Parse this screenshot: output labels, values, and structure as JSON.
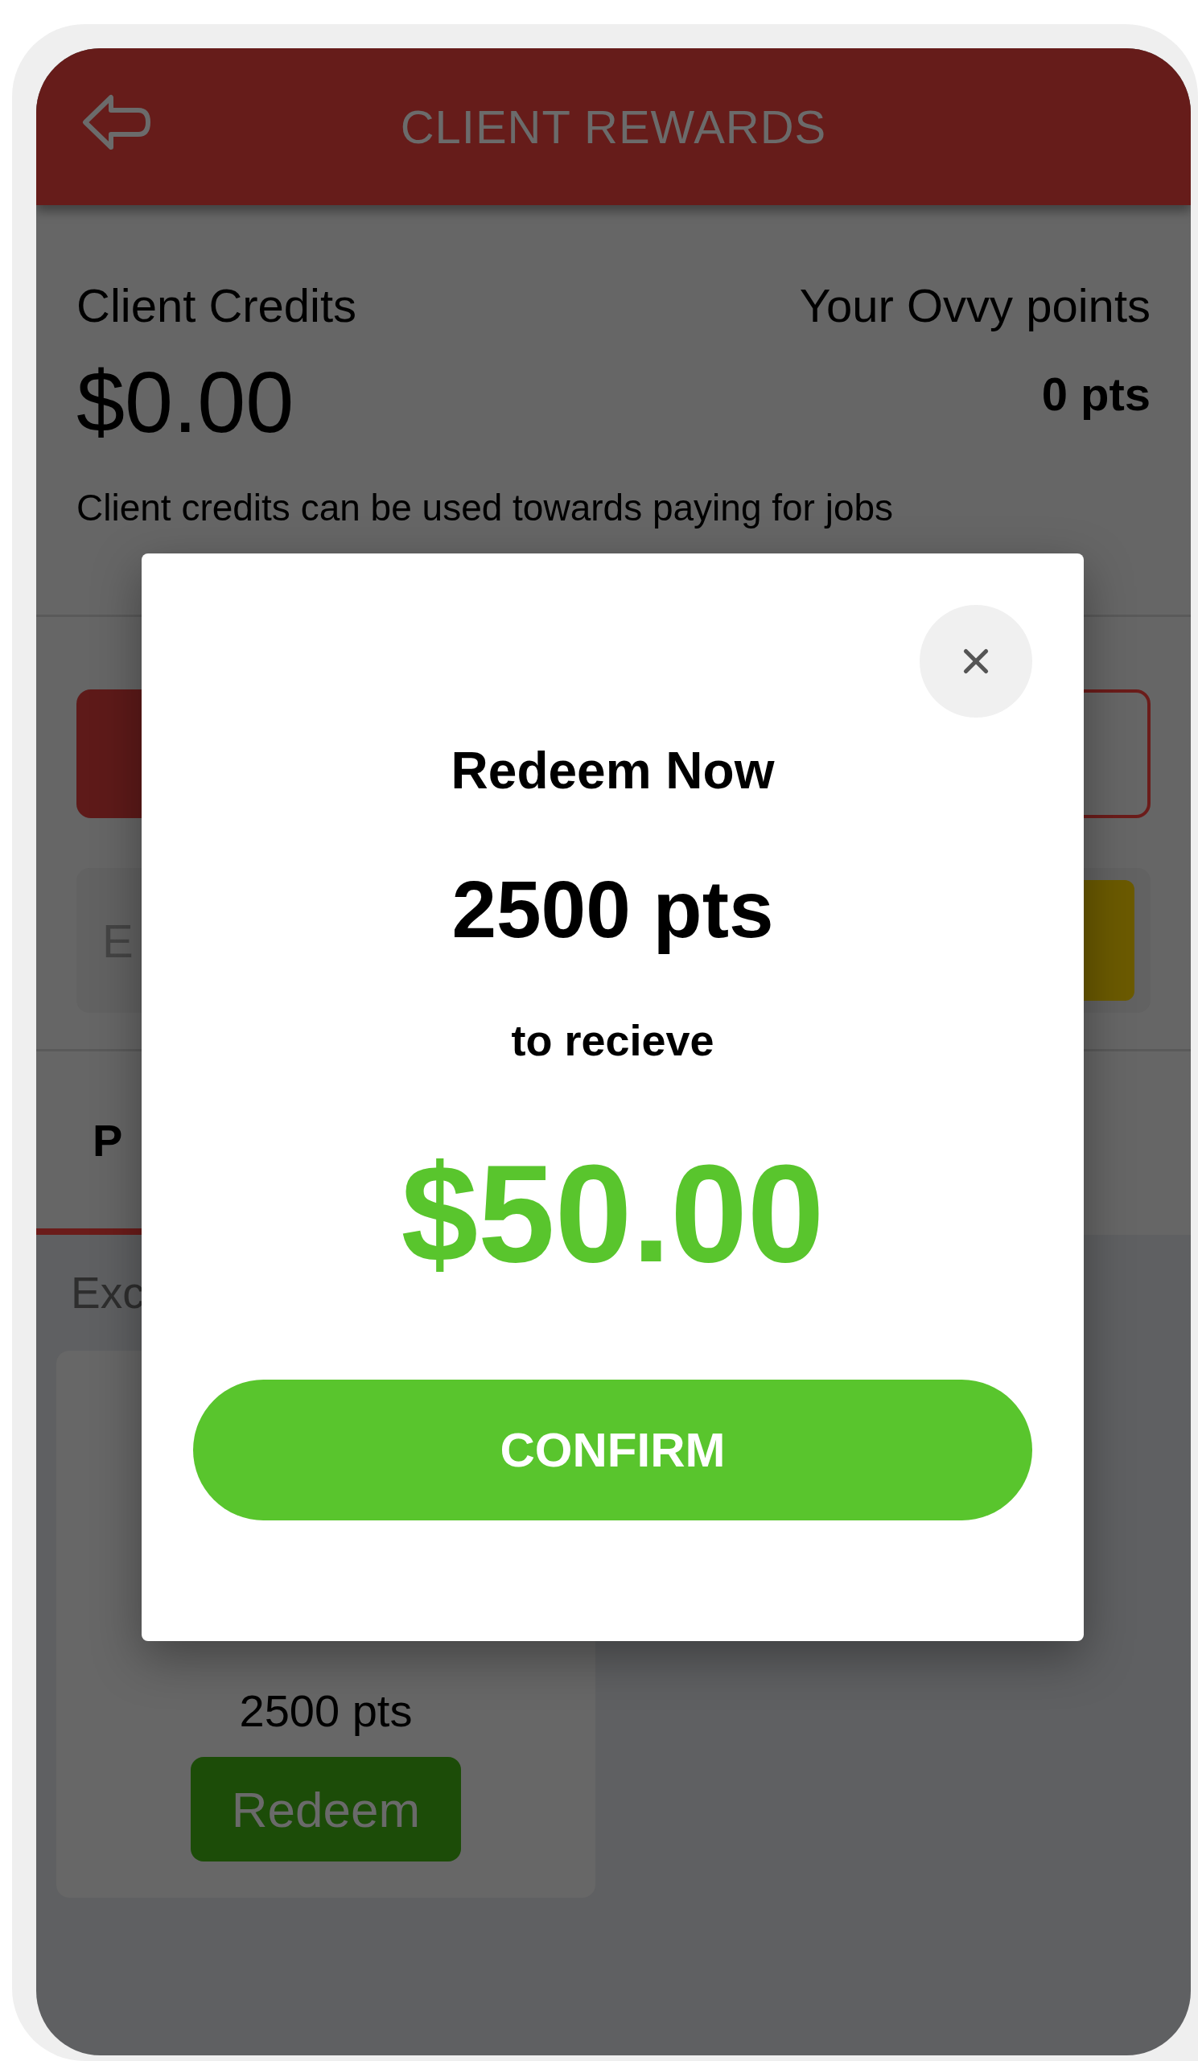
{
  "header": {
    "title": "CLIENT REWARDS"
  },
  "credits": {
    "label": "Client Credits",
    "amount": "$0.00",
    "note": "Client credits can be used towards paying for jobs"
  },
  "points": {
    "label": "Your Ovvy points",
    "value": "0 pts"
  },
  "promo_field": {
    "placeholder": "E"
  },
  "tabs": [
    {
      "label": "P",
      "selected": true
    }
  ],
  "section_label": "Exc",
  "reward_cards": [
    {
      "points": "2500 pts",
      "button": "Redeem"
    }
  ],
  "dialog": {
    "title": "Redeem Now",
    "points": "2500 pts",
    "caption": "to recieve",
    "amount": "$50.00",
    "confirm": "CONFIRM"
  }
}
